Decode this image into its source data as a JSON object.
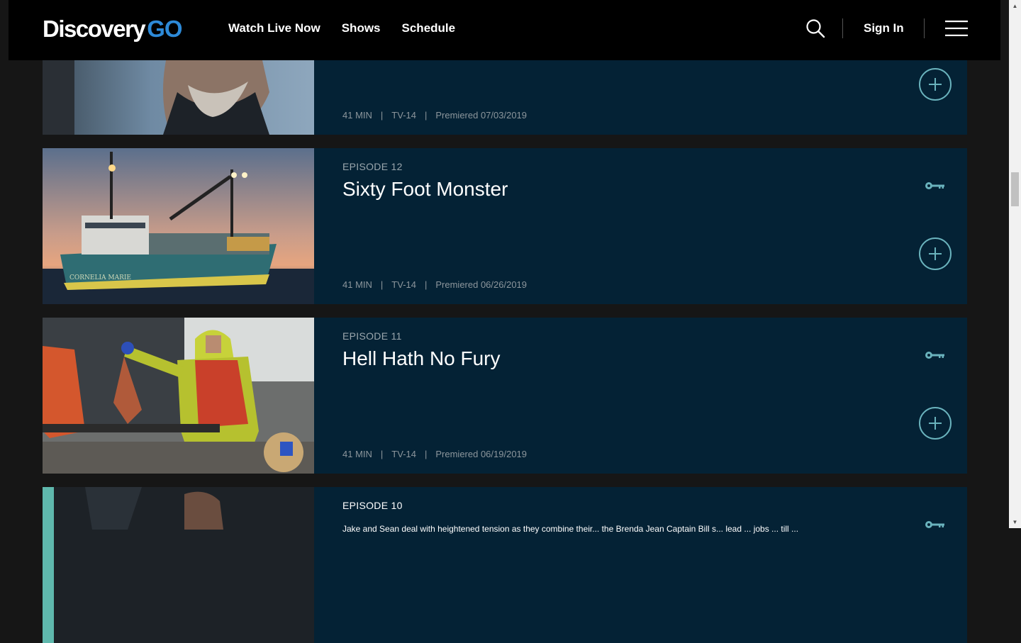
{
  "header": {
    "logo_primary": "Discovery",
    "logo_secondary": "GO",
    "nav": [
      "Watch Live Now",
      "Shows",
      "Schedule"
    ],
    "sign_in": "Sign In"
  },
  "episodes": [
    {
      "label": "",
      "title": "",
      "duration": "41 MIN",
      "rating": "TV-14",
      "premiered": "Premiered 07/03/2019"
    },
    {
      "label": "EPISODE 12",
      "title": "Sixty Foot Monster",
      "duration": "41 MIN",
      "rating": "TV-14",
      "premiered": "Premiered 06/26/2019"
    },
    {
      "label": "EPISODE 11",
      "title": "Hell Hath No Fury",
      "duration": "41 MIN",
      "rating": "TV-14",
      "premiered": "Premiered 06/19/2019"
    },
    {
      "label": "EPISODE 10",
      "description": "Jake and Sean deal with heightened tension as they combine their... the Brenda Jean Captain Bill s... lead ... jobs ... till ..."
    }
  ],
  "colors": {
    "card_bg": "#042235",
    "accent": "#6ab3bd",
    "logo_go": "#2d8ad8",
    "header_bg": "#000000",
    "page_bg": "#161616"
  },
  "icons": {
    "search": "search-icon",
    "menu": "hamburger-menu-icon",
    "locked": "key-icon",
    "add": "plus-circle-icon"
  }
}
